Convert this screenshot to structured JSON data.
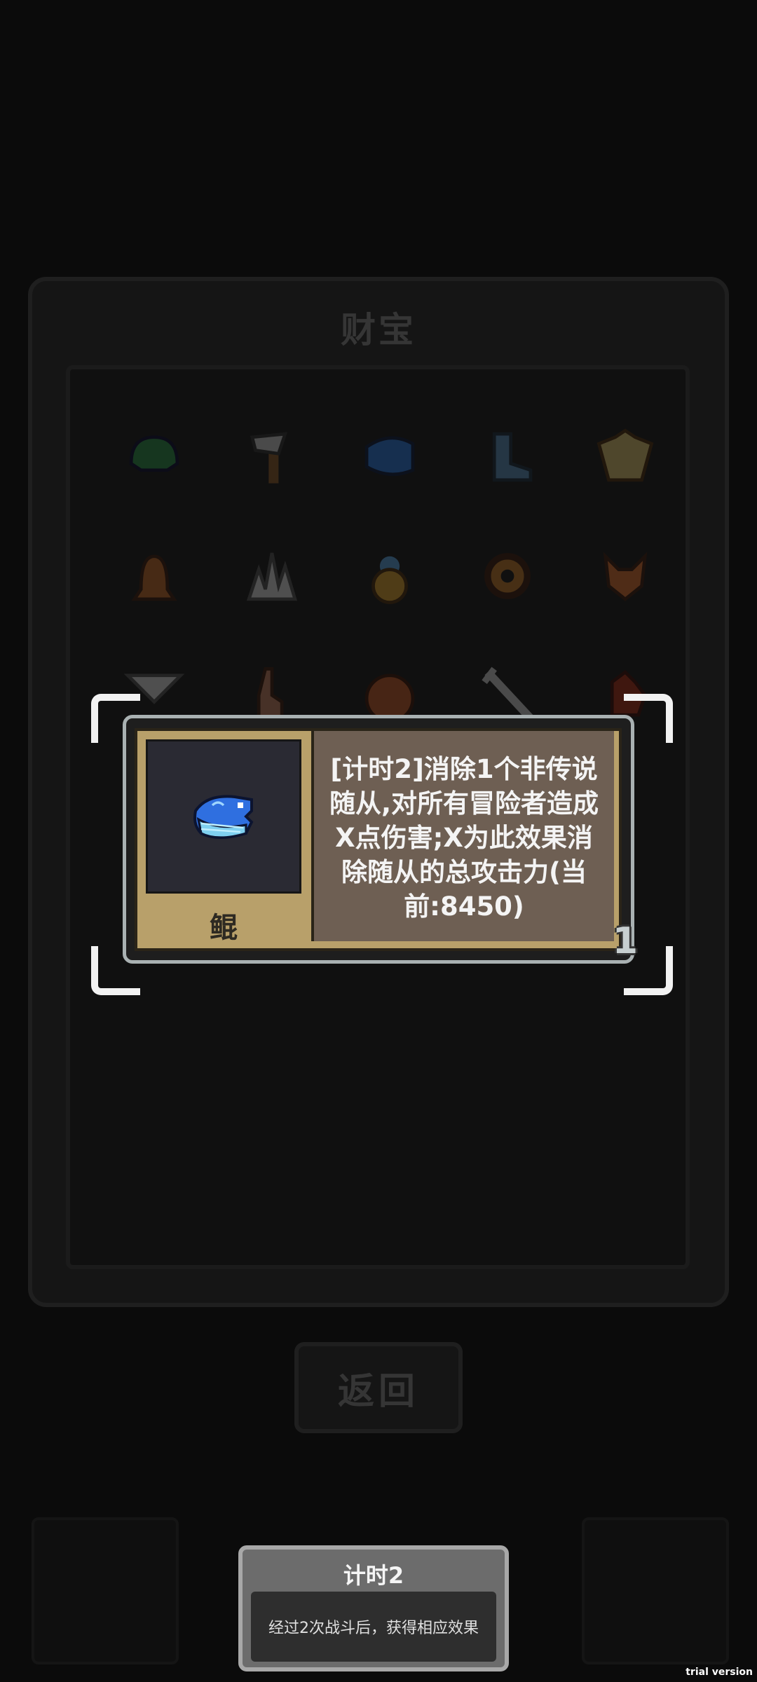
{
  "panel": {
    "title": "财宝",
    "back_label": "返回",
    "items": [
      {
        "icon": "green-helmet-icon"
      },
      {
        "icon": "axe-icon"
      },
      {
        "icon": "blue-fish-icon"
      },
      {
        "icon": "boot-icon"
      },
      {
        "icon": "winged-helmet-icon"
      },
      {
        "icon": "bell-icon"
      },
      {
        "icon": "crystal-icon"
      },
      {
        "icon": "gourd-icon"
      },
      {
        "icon": "gear-icon"
      },
      {
        "icon": "fox-icon"
      },
      {
        "icon": "scroll-icon"
      },
      {
        "icon": "rabbit-icon"
      },
      {
        "icon": "shell-icon"
      },
      {
        "icon": "staff-icon"
      },
      {
        "icon": "rooster-icon"
      }
    ]
  },
  "card": {
    "name": "鲲",
    "icon": "blue-fish-icon",
    "description": "[计时2]消除1个非传说随从,对所有冒险者造成X点伤害;X为此效果消除随从的总攻击力(当前:8450)",
    "count": "1"
  },
  "tooltip": {
    "title": "计时2",
    "body": "经过2次战斗后，获得相应效果"
  },
  "watermark": "trial version",
  "colors": {
    "card_gold": "#b8a06a",
    "card_desc_bg": "#6e5f53",
    "highlight": "#f2f2f2"
  }
}
